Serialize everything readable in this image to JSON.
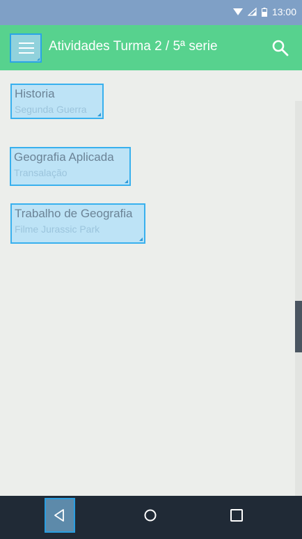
{
  "status_bar": {
    "time": "13:00",
    "icons": [
      "wifi-icon",
      "signal-icon",
      "battery-icon"
    ]
  },
  "app_bar": {
    "title": "Atividades Turma 2 / 5ª serie",
    "menu_icon": "hamburger-menu-icon",
    "search_icon": "search-icon",
    "color": "#57d28e"
  },
  "activities": [
    {
      "title": "Historia",
      "subtitle": "Segunda Guerra"
    },
    {
      "title": "Geografia Aplicada",
      "subtitle": "Transalação"
    },
    {
      "title": "Trabalho de Geografia",
      "subtitle": "Filme Jurassic Park"
    }
  ],
  "nav_bar": {
    "back_icon": "back-triangle-icon",
    "home_icon": "home-circle-icon",
    "recents_icon": "recents-square-icon"
  },
  "colors": {
    "status_bar": "#7fa0c6",
    "highlight": "#38b0ee",
    "background": "#eceeeb"
  }
}
